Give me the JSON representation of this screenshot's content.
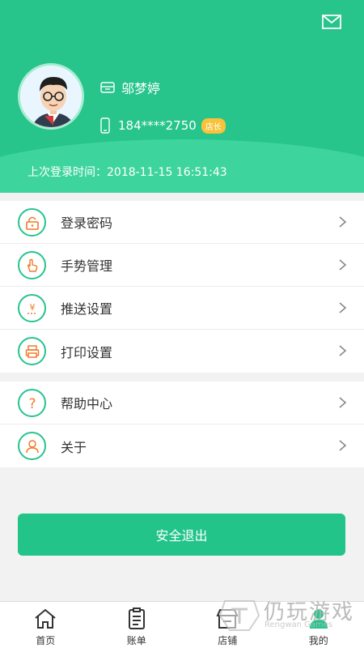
{
  "header": {
    "user_name": "邬梦婷",
    "phone": "184****2750",
    "role_badge": "店长",
    "last_login": "上次登录时间：2018-11-15 16:51:43"
  },
  "settings_group1": [
    {
      "label": "登录密码",
      "icon": "lock-icon"
    },
    {
      "label": "手势管理",
      "icon": "gesture-hand-icon"
    },
    {
      "label": "推送设置",
      "icon": "yen-push-icon"
    },
    {
      "label": "打印设置",
      "icon": "printer-icon"
    }
  ],
  "settings_group2": [
    {
      "label": "帮助中心",
      "icon": "question-icon"
    },
    {
      "label": "关于",
      "icon": "user-icon"
    }
  ],
  "logout_label": "安全退出",
  "tabbar": [
    {
      "label": "首页",
      "icon": "home-icon"
    },
    {
      "label": "账单",
      "icon": "clipboard-icon"
    },
    {
      "label": "店铺",
      "icon": "store-icon"
    },
    {
      "label": "我的",
      "icon": "profile-icon"
    }
  ],
  "watermark": {
    "title": "仍玩游戏",
    "subtitle": "Rengwan Games"
  },
  "colors": {
    "primary": "#27c48c",
    "accent_orange": "#f07a2a",
    "badge": "#f8c23a"
  }
}
